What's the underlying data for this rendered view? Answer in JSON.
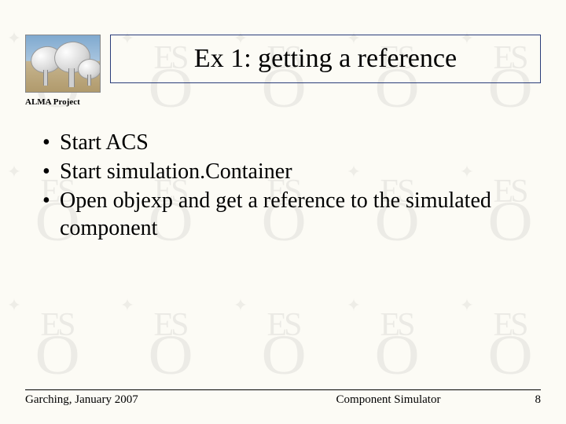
{
  "header": {
    "title": "Ex 1: getting a reference",
    "project_label": "ALMA Project"
  },
  "bullets": [
    "Start ACS",
    "Start simulation.Container",
    "Open objexp and get a reference to the simulated component"
  ],
  "footer": {
    "location_date": "Garching, January 2007",
    "center": "Component Simulator",
    "page_number": "8"
  },
  "watermark": {
    "monogram_top": "ES",
    "monogram_bottom": "O"
  }
}
